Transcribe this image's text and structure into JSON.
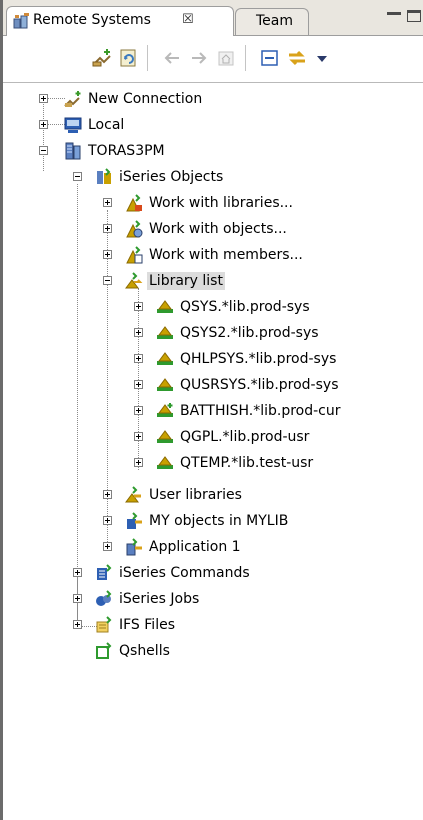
{
  "view": {
    "tabs": [
      {
        "label": "Remote Systems",
        "close": "☒",
        "icon": "remote-systems-icon"
      },
      {
        "label": "Team"
      }
    ]
  },
  "toolbar": {
    "icons": [
      "new-connection-icon",
      "refresh-icon",
      "back-icon",
      "forward-icon",
      "home-icon",
      "collapse-all-icon",
      "link-with-editor-icon",
      "view-menu-icon"
    ]
  },
  "tree": {
    "nodes": [
      {
        "label": "New Connection",
        "icon": "new-connection-icon",
        "expander": "plus"
      },
      {
        "label": "Local",
        "icon": "monitor-icon",
        "expander": "plus"
      },
      {
        "label": "TORAS3PM",
        "icon": "server-icon",
        "expander": "minus"
      },
      {
        "label": "iSeries Objects",
        "icon": "iseries-objects-icon",
        "expander": "minus"
      },
      {
        "label": "Work with libraries...",
        "icon": "work-libraries-icon",
        "expander": "plus"
      },
      {
        "label": "Work with objects...",
        "icon": "work-objects-icon",
        "expander": "plus"
      },
      {
        "label": "Work with members...",
        "icon": "work-members-icon",
        "expander": "plus"
      },
      {
        "label": "Library list",
        "icon": "library-list-icon",
        "expander": "minus",
        "selected": true
      },
      {
        "label": "QSYS.*lib.prod-sys",
        "icon": "library-icon",
        "expander": "plus"
      },
      {
        "label": "QSYS2.*lib.prod-sys",
        "icon": "library-icon",
        "expander": "plus"
      },
      {
        "label": "QHLPSYS.*lib.prod-sys",
        "icon": "library-icon",
        "expander": "plus"
      },
      {
        "label": "QUSRSYS.*lib.prod-sys",
        "icon": "library-icon",
        "expander": "plus"
      },
      {
        "label": "BATTHISH.*lib.prod-cur",
        "icon": "current-library-icon",
        "expander": "plus"
      },
      {
        "label": "QGPL.*lib.prod-usr",
        "icon": "library-icon",
        "expander": "plus"
      },
      {
        "label": "QTEMP.*lib.test-usr",
        "icon": "library-icon",
        "expander": "plus"
      },
      {
        "label": "User libraries",
        "icon": "user-libraries-icon",
        "expander": "plus"
      },
      {
        "label": "MY objects in MYLIB",
        "icon": "object-filter-icon",
        "expander": "plus"
      },
      {
        "label": "Application 1",
        "icon": "application-filter-icon",
        "expander": "plus"
      },
      {
        "label": "iSeries Commands",
        "icon": "iseries-commands-icon",
        "expander": "plus"
      },
      {
        "label": "iSeries Jobs",
        "icon": "iseries-jobs-icon",
        "expander": "plus"
      },
      {
        "label": "IFS Files",
        "icon": "ifs-files-icon",
        "expander": "plus"
      },
      {
        "label": "Qshells",
        "icon": "qshells-icon"
      }
    ]
  },
  "colors": {
    "library": "#c8a000",
    "green": "#2e9a2e",
    "blue": "#2d5fb3",
    "selection": "#dcdcdc"
  }
}
